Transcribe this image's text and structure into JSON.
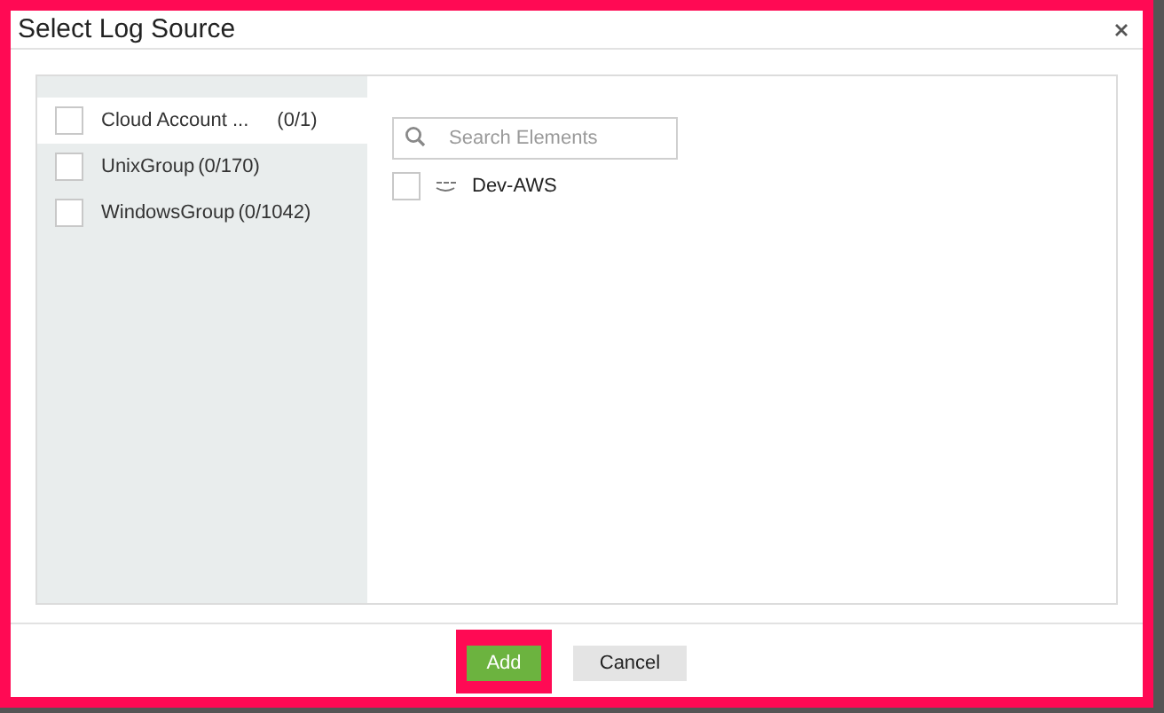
{
  "dialog": {
    "title": "Select Log Source"
  },
  "groups": [
    {
      "name": "Cloud Account ...",
      "count": "(0/1)",
      "checked": false,
      "selected": true
    },
    {
      "name": "UnixGroup",
      "count": "(0/170)",
      "checked": false,
      "selected": false
    },
    {
      "name": "WindowsGroup",
      "count": "(0/1042)",
      "checked": false,
      "selected": false
    }
  ],
  "search": {
    "placeholder": "Search Elements"
  },
  "elements": [
    {
      "name": "Dev-AWS",
      "checked": false
    }
  ],
  "buttons": [
    {
      "label": "Add",
      "kind": "primary",
      "highlighted": true
    },
    {
      "label": "Cancel",
      "kind": "secondary",
      "highlighted": false
    }
  ]
}
